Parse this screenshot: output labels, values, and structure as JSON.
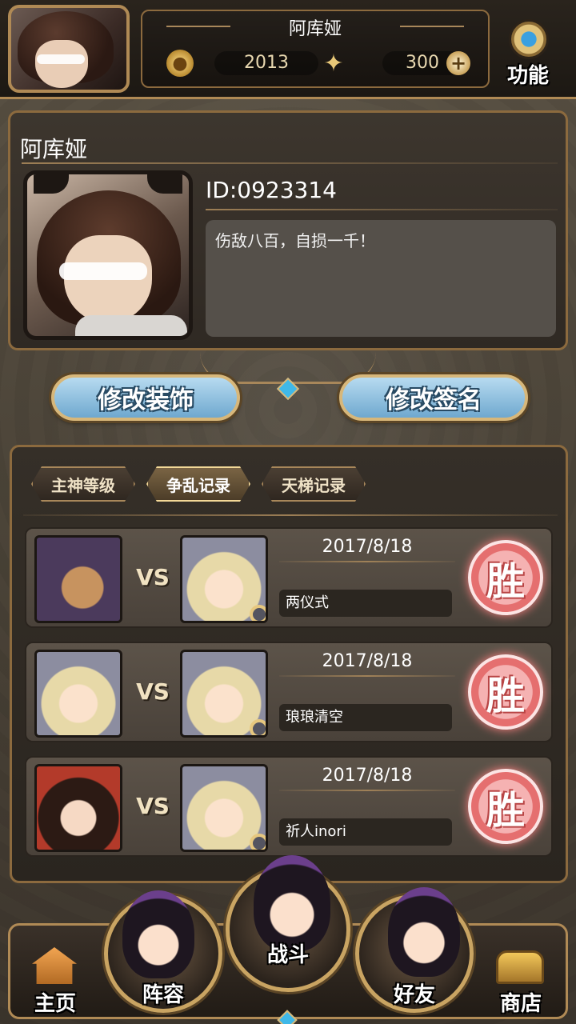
{
  "header": {
    "player_name": "阿库娅",
    "gold": "2013",
    "gems": "300",
    "function_label": "功能"
  },
  "profile": {
    "name": "阿库娅",
    "id": "ID:0923314",
    "signature": "伤敌八百，自损一千！"
  },
  "buttons": {
    "edit_decoration": "修改装饰",
    "edit_signature": "修改签名"
  },
  "tabs": [
    {
      "label": "主神等级",
      "active": false
    },
    {
      "label": "争乱记录",
      "active": true
    },
    {
      "label": "天梯记录",
      "active": false
    }
  ],
  "records": [
    {
      "vs": "VS",
      "date": "2017/8/18",
      "opponent": "两仪式",
      "result": "胜"
    },
    {
      "vs": "VS",
      "date": "2017/8/18",
      "opponent": "琅琅清空",
      "result": "胜"
    },
    {
      "vs": "VS",
      "date": "2017/8/18",
      "opponent": "祈人inori",
      "result": "胜"
    }
  ],
  "nav": {
    "home": "主页",
    "team": "阵容",
    "battle": "战斗",
    "friends": "好友",
    "shop": "商店"
  },
  "colors": {
    "accent_gold": "#b08a55",
    "button_blue": "#6fa8cf",
    "win_red": "#e56f6f",
    "gem_blue": "#3fb8e8"
  },
  "icons": [
    "flame-icon",
    "butterfly-icon",
    "plus-icon",
    "gear-icon",
    "magnify-icon",
    "house-icon",
    "chest-icon"
  ]
}
